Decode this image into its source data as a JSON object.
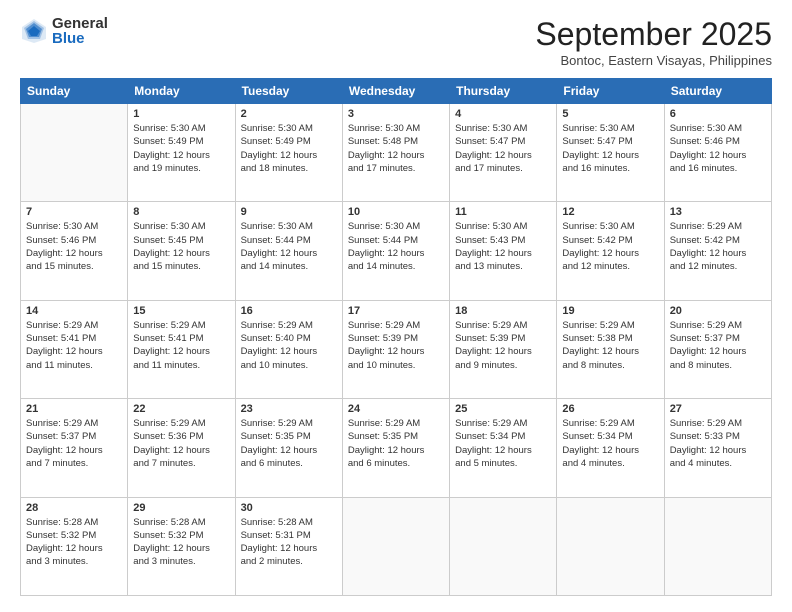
{
  "logo": {
    "general": "General",
    "blue": "Blue"
  },
  "header": {
    "month": "September 2025",
    "location": "Bontoc, Eastern Visayas, Philippines"
  },
  "weekdays": [
    "Sunday",
    "Monday",
    "Tuesday",
    "Wednesday",
    "Thursday",
    "Friday",
    "Saturday"
  ],
  "weeks": [
    [
      {
        "day": "",
        "info": ""
      },
      {
        "day": "1",
        "info": "Sunrise: 5:30 AM\nSunset: 5:49 PM\nDaylight: 12 hours\nand 19 minutes."
      },
      {
        "day": "2",
        "info": "Sunrise: 5:30 AM\nSunset: 5:49 PM\nDaylight: 12 hours\nand 18 minutes."
      },
      {
        "day": "3",
        "info": "Sunrise: 5:30 AM\nSunset: 5:48 PM\nDaylight: 12 hours\nand 17 minutes."
      },
      {
        "day": "4",
        "info": "Sunrise: 5:30 AM\nSunset: 5:47 PM\nDaylight: 12 hours\nand 17 minutes."
      },
      {
        "day": "5",
        "info": "Sunrise: 5:30 AM\nSunset: 5:47 PM\nDaylight: 12 hours\nand 16 minutes."
      },
      {
        "day": "6",
        "info": "Sunrise: 5:30 AM\nSunset: 5:46 PM\nDaylight: 12 hours\nand 16 minutes."
      }
    ],
    [
      {
        "day": "7",
        "info": "Sunrise: 5:30 AM\nSunset: 5:46 PM\nDaylight: 12 hours\nand 15 minutes."
      },
      {
        "day": "8",
        "info": "Sunrise: 5:30 AM\nSunset: 5:45 PM\nDaylight: 12 hours\nand 15 minutes."
      },
      {
        "day": "9",
        "info": "Sunrise: 5:30 AM\nSunset: 5:44 PM\nDaylight: 12 hours\nand 14 minutes."
      },
      {
        "day": "10",
        "info": "Sunrise: 5:30 AM\nSunset: 5:44 PM\nDaylight: 12 hours\nand 14 minutes."
      },
      {
        "day": "11",
        "info": "Sunrise: 5:30 AM\nSunset: 5:43 PM\nDaylight: 12 hours\nand 13 minutes."
      },
      {
        "day": "12",
        "info": "Sunrise: 5:30 AM\nSunset: 5:42 PM\nDaylight: 12 hours\nand 12 minutes."
      },
      {
        "day": "13",
        "info": "Sunrise: 5:29 AM\nSunset: 5:42 PM\nDaylight: 12 hours\nand 12 minutes."
      }
    ],
    [
      {
        "day": "14",
        "info": "Sunrise: 5:29 AM\nSunset: 5:41 PM\nDaylight: 12 hours\nand 11 minutes."
      },
      {
        "day": "15",
        "info": "Sunrise: 5:29 AM\nSunset: 5:41 PM\nDaylight: 12 hours\nand 11 minutes."
      },
      {
        "day": "16",
        "info": "Sunrise: 5:29 AM\nSunset: 5:40 PM\nDaylight: 12 hours\nand 10 minutes."
      },
      {
        "day": "17",
        "info": "Sunrise: 5:29 AM\nSunset: 5:39 PM\nDaylight: 12 hours\nand 10 minutes."
      },
      {
        "day": "18",
        "info": "Sunrise: 5:29 AM\nSunset: 5:39 PM\nDaylight: 12 hours\nand 9 minutes."
      },
      {
        "day": "19",
        "info": "Sunrise: 5:29 AM\nSunset: 5:38 PM\nDaylight: 12 hours\nand 8 minutes."
      },
      {
        "day": "20",
        "info": "Sunrise: 5:29 AM\nSunset: 5:37 PM\nDaylight: 12 hours\nand 8 minutes."
      }
    ],
    [
      {
        "day": "21",
        "info": "Sunrise: 5:29 AM\nSunset: 5:37 PM\nDaylight: 12 hours\nand 7 minutes."
      },
      {
        "day": "22",
        "info": "Sunrise: 5:29 AM\nSunset: 5:36 PM\nDaylight: 12 hours\nand 7 minutes."
      },
      {
        "day": "23",
        "info": "Sunrise: 5:29 AM\nSunset: 5:35 PM\nDaylight: 12 hours\nand 6 minutes."
      },
      {
        "day": "24",
        "info": "Sunrise: 5:29 AM\nSunset: 5:35 PM\nDaylight: 12 hours\nand 6 minutes."
      },
      {
        "day": "25",
        "info": "Sunrise: 5:29 AM\nSunset: 5:34 PM\nDaylight: 12 hours\nand 5 minutes."
      },
      {
        "day": "26",
        "info": "Sunrise: 5:29 AM\nSunset: 5:34 PM\nDaylight: 12 hours\nand 4 minutes."
      },
      {
        "day": "27",
        "info": "Sunrise: 5:29 AM\nSunset: 5:33 PM\nDaylight: 12 hours\nand 4 minutes."
      }
    ],
    [
      {
        "day": "28",
        "info": "Sunrise: 5:28 AM\nSunset: 5:32 PM\nDaylight: 12 hours\nand 3 minutes."
      },
      {
        "day": "29",
        "info": "Sunrise: 5:28 AM\nSunset: 5:32 PM\nDaylight: 12 hours\nand 3 minutes."
      },
      {
        "day": "30",
        "info": "Sunrise: 5:28 AM\nSunset: 5:31 PM\nDaylight: 12 hours\nand 2 minutes."
      },
      {
        "day": "",
        "info": ""
      },
      {
        "day": "",
        "info": ""
      },
      {
        "day": "",
        "info": ""
      },
      {
        "day": "",
        "info": ""
      }
    ]
  ]
}
